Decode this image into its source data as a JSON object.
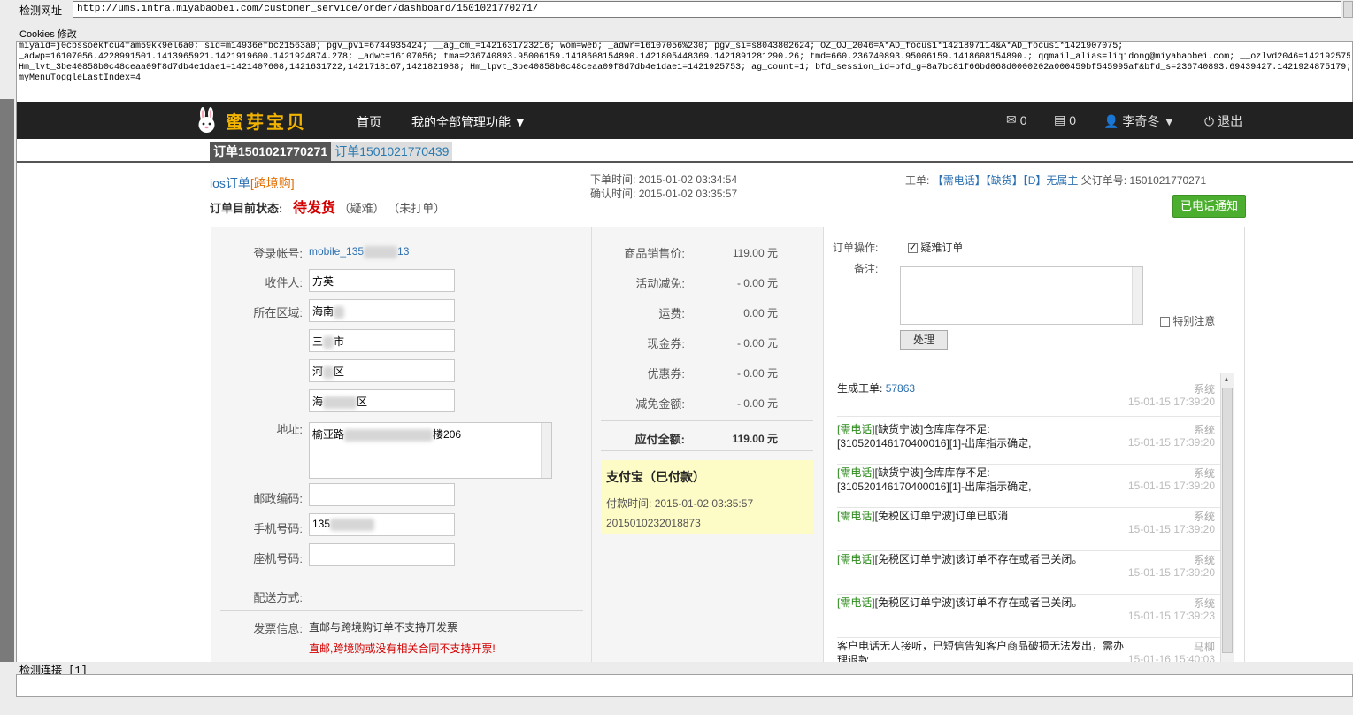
{
  "inspector": {
    "url_label": "检测网址",
    "url": "http://ums.intra.miyabaobei.com/customer_service/order/dashboard/1501021770271/",
    "cookies_label": "Cookies 修改",
    "cookie_lines": [
      "miyaid=j0cbssoekfcu4fam59kk9el6a0; sid=m14936efbc21563a0; pgv_pvi=6744935424; __ag_cm_=1421631723216; wom=web; _adwr=16107056%230; pgv_si=s8043802624; OZ_OJ_2046=A*AD_focus1*1421897114&A*AD_focus1*1421907075;",
      "_adwp=16107056.4228991501.1413965921.1421919600.1421924874.278; _adwc=16107056; tma=236740893.95006159.1418608154890.1421805448369.1421891281290.26; tmd=660.236740893.95006159.1418608154890.; qqmail_alias=liqidong@miyabaobei.com; __ozlvd2046=1421925752;",
      "Hm_lvt_3be40858b0c48ceaa09f8d7db4e1dae1=1421407608,1421631722,1421718167,1421821988; Hm_lpvt_3be40858b0c48ceaa09f8d7db4e1dae1=1421925753; ag_count=1; bfd_session_id=bfd_g=8a7bc81f66bd068d0000202a000459bf545995af&bfd_s=236740893.69439427.1421924875179;",
      "myMenuToggleLastIndex=4"
    ],
    "status_label": "检测连接 [1]"
  },
  "nav": {
    "logo_text": "蜜芽宝贝",
    "home": "首页",
    "all_functions": "我的全部管理功能 ▼",
    "mail_count": "0",
    "doc_count": "0",
    "user": "李奇冬 ▼",
    "logout": "退出"
  },
  "tabs": [
    {
      "label": "订单1501021770271"
    },
    {
      "label": "订单1501021770439"
    }
  ],
  "order": {
    "source": "ios订单",
    "type": "[跨境购]",
    "status_label": "订单目前状态:",
    "status": "待发货",
    "status_extra1": "（疑难）",
    "status_extra2": "（未打单）",
    "order_time_label": "下单时间:",
    "order_time": "2015-01-02 03:34:54",
    "confirm_time_label": "确认时间:",
    "confirm_time": "2015-01-02 03:35:57",
    "ticket_label": "工单:",
    "ticket_tags": "【需电话】【缺货】【D】无属主",
    "parent_label": "父订单号:",
    "parent_no": "1501021770271",
    "notify_button": "已电话通知"
  },
  "customer": {
    "account_label": "登录帐号:",
    "account_prefix": "mobile_135",
    "account_suffix": "13",
    "receiver_label": "收件人:",
    "receiver": "方英",
    "region_label": "所在区域:",
    "region1": "海南",
    "region2_a": "三",
    "region2_b": "市",
    "region3_a": "河",
    "region3_b": "区",
    "region4_a": "海",
    "region4_b": "区",
    "address_label": "地址:",
    "address_prefix": "榆亚路",
    "address_suffix": "楼206",
    "zip_label": "邮政编码:",
    "zip": "",
    "mobile_label": "手机号码:",
    "mobile_prefix": "135",
    "phone_label": "座机号码:",
    "phone": "",
    "delivery_label": "配送方式:",
    "invoice_label": "发票信息:",
    "invoice_note": "直邮与跨境购订单不支持开发票",
    "invoice_warning": "直邮,跨境购或没有相关合同不支持开票!"
  },
  "price": {
    "rows": [
      {
        "label": "商品销售价:",
        "value": "119.00 元"
      },
      {
        "label": "活动减免:",
        "value": "- 0.00 元"
      },
      {
        "label": "运费:",
        "value": "0.00 元"
      },
      {
        "label": "现金券:",
        "value": "- 0.00 元"
      },
      {
        "label": "优惠券:",
        "value": "- 0.00 元"
      },
      {
        "label": "减免金额:",
        "value": "- 0.00 元"
      }
    ],
    "total_label": "应付全额:",
    "total_value": "119.00 元",
    "pay_method": "支付宝（已付款）",
    "pay_time_label": "付款时间:",
    "pay_time": "2015-01-02 03:35:57",
    "pay_serial": "2015010232018873"
  },
  "ops": {
    "op_label": "订单操作:",
    "difficult_label": "疑难订单",
    "note_label": "备注:",
    "special_label": "特别注意",
    "process_button": "处理"
  },
  "log": [
    {
      "text_a": "生成工单:",
      "text_b": "57863",
      "who": "系统",
      "when": "15-01-15 17:39:20"
    },
    {
      "tag": "[需电话]",
      "text": "[缺货宁波]仓库库存不足:",
      "text2": "[310520146170400016][1]-出库指示确定,",
      "who": "系统",
      "when": "15-01-15 17:39:20"
    },
    {
      "tag": "[需电话]",
      "text": "[缺货宁波]仓库库存不足:",
      "text2": "[310520146170400016][1]-出库指示确定,",
      "who": "系统",
      "when": "15-01-15 17:39:20"
    },
    {
      "tag": "[需电话]",
      "text": "[免税区订单宁波]订单已取消",
      "who": "系统",
      "when": "15-01-15 17:39:20"
    },
    {
      "tag": "[需电话]",
      "text": "[免税区订单宁波]该订单不存在或者已关闭。",
      "who": "系统",
      "when": "15-01-15 17:39:20"
    },
    {
      "tag": "[需电话]",
      "text": "[免税区订单宁波]该订单不存在或者已关闭。",
      "who": "系统",
      "when": "15-01-15 17:39:23"
    },
    {
      "text": "客户电话无人接听，已短信告知客户商品破损无法发出，需办理退款",
      "who": "马柳",
      "when": "15-01-16 15:40:03"
    }
  ]
}
